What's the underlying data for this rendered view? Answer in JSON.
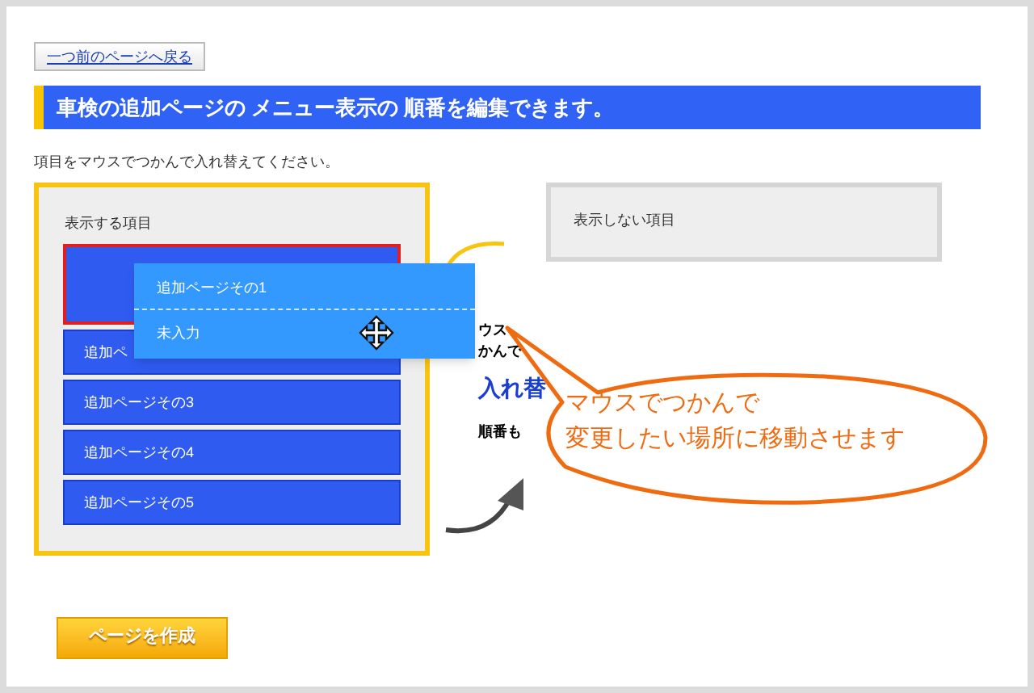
{
  "back_link": "一つ前のページへ戻る",
  "heading": "車検の追加ページの メニュー表示の 順番を編集できます。",
  "instruction": "項目をマウスでつかんで入れ替えてください。",
  "shown_panel": {
    "title": "表示する項目",
    "items": [
      {
        "kind": "drop-slot"
      },
      {
        "kind": "item",
        "label": "追加ペ"
      },
      {
        "kind": "item",
        "label": "追加ページその3"
      },
      {
        "kind": "item",
        "label": "追加ページその4"
      },
      {
        "kind": "item",
        "label": "追加ページその5"
      }
    ]
  },
  "hidden_panel": {
    "title": "表示しない項目"
  },
  "dragged_item": {
    "title": "追加ページその1",
    "subtitle": "未入力"
  },
  "tip": [
    {
      "kind": "plain",
      "text": "ウス"
    },
    {
      "kind": "plain",
      "text": "かんで"
    },
    {
      "kind": "emphasis",
      "text": "入れ替"
    },
    {
      "kind": "plain",
      "text": "順番も"
    }
  ],
  "callout": {
    "lines": [
      "マウスでつかんで",
      "変更したい場所に移動させます"
    ]
  },
  "create_button": "ページを作成"
}
